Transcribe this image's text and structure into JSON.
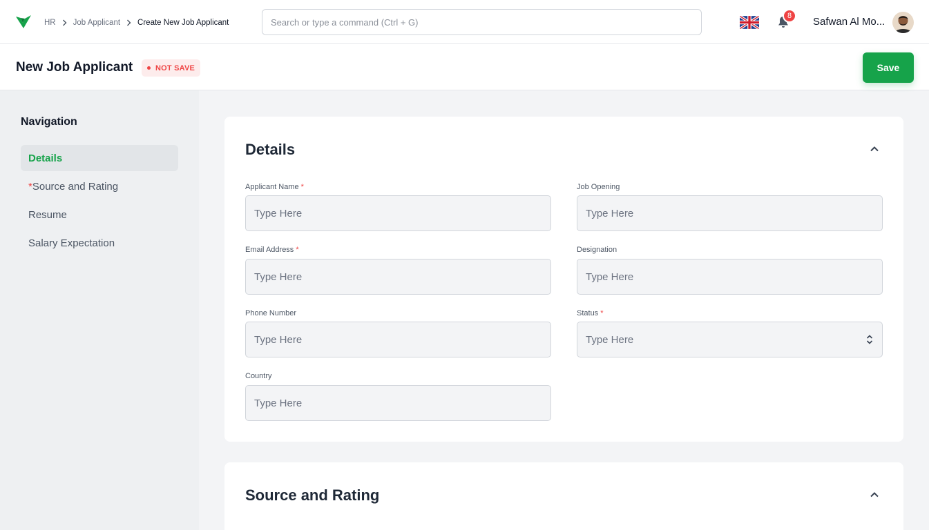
{
  "breadcrumb": [
    "HR",
    "Job Applicant",
    "Create New Job Applicant"
  ],
  "search": {
    "placeholder": "Search or type a command (Ctrl + G)"
  },
  "notifications": {
    "count": "8"
  },
  "user": {
    "name": "Safwan Al Mo..."
  },
  "page": {
    "title": "New Job Applicant",
    "status": "NOT SAVE",
    "save_label": "Save"
  },
  "navigation": {
    "title": "Navigation",
    "items": [
      {
        "label": "Details",
        "active": true,
        "required": false
      },
      {
        "label": "Source and Rating",
        "active": false,
        "required": true
      },
      {
        "label": "Resume",
        "active": false,
        "required": false
      },
      {
        "label": "Salary Expectation",
        "active": false,
        "required": false
      }
    ]
  },
  "details": {
    "title": "Details",
    "fields": [
      {
        "label": "Applicant Name",
        "required": true,
        "placeholder": "Type Here"
      },
      {
        "label": "Job Opening",
        "required": false,
        "placeholder": "Type Here"
      },
      {
        "label": "Email Address",
        "required": true,
        "placeholder": "Type Here"
      },
      {
        "label": "Designation",
        "required": false,
        "placeholder": "Type Here"
      },
      {
        "label": "Phone Number",
        "required": false,
        "placeholder": "Type Here"
      },
      {
        "label": "Status",
        "required": true,
        "placeholder": "Type Here"
      },
      {
        "label": "Country",
        "required": false,
        "placeholder": "Type Here"
      }
    ]
  },
  "source_rating": {
    "title": "Source and Rating"
  },
  "icons": [
    "app-logo-icon",
    "chevron-right-icon",
    "uk-flag-icon",
    "bell-icon",
    "chevron-up-icon",
    "select-arrows-icon"
  ],
  "colors": {
    "accent": "#16a34a",
    "danger": "#ef4444",
    "badge_bg": "#fdecec"
  }
}
